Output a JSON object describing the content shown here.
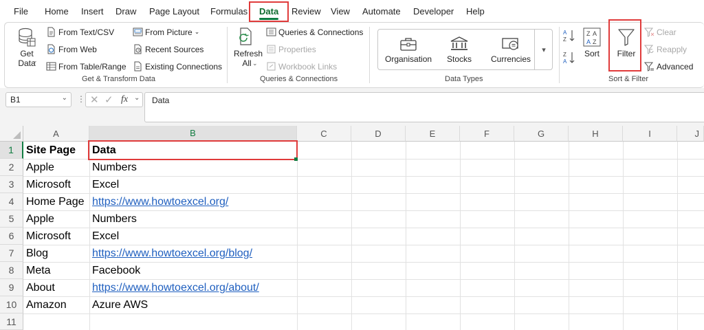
{
  "menu": {
    "tabs": [
      "File",
      "Home",
      "Insert",
      "Draw",
      "Page Layout",
      "Formulas",
      "Data",
      "Review",
      "View",
      "Automate",
      "Developer",
      "Help"
    ],
    "active": "Data"
  },
  "ribbon": {
    "get_transform": {
      "get_data": "Get Data",
      "from_text_csv": "From Text/CSV",
      "from_web": "From Web",
      "from_table_range": "From Table/Range",
      "from_picture": "From Picture",
      "recent_sources": "Recent Sources",
      "existing_connections": "Existing Connections",
      "label": "Get & Transform Data"
    },
    "queries": {
      "refresh_all": "Refresh All",
      "queries_connections": "Queries & Connections",
      "properties": "Properties",
      "workbook_links": "Workbook Links",
      "label": "Queries & Connections"
    },
    "data_types": {
      "items": [
        "Organisation",
        "Stocks",
        "Currencies"
      ],
      "label": "Data Types"
    },
    "sort_filter": {
      "sort": "Sort",
      "filter": "Filter",
      "clear": "Clear",
      "reapply": "Reapply",
      "advanced": "Advanced",
      "label": "Sort & Filter"
    }
  },
  "formula_bar": {
    "name_box": "B1",
    "fx": "fx",
    "value": "Data"
  },
  "sheet": {
    "columns": [
      "A",
      "B",
      "C",
      "D",
      "E",
      "F",
      "G",
      "H",
      "I",
      "J"
    ],
    "rows": [
      "1",
      "2",
      "3",
      "4",
      "5",
      "6",
      "7",
      "8",
      "9",
      "10",
      "11"
    ],
    "selected_column": "B",
    "selected_row": "1",
    "cells": [
      {
        "a": "Site Page",
        "b": "Data"
      },
      {
        "a": "Apple",
        "b": "Numbers"
      },
      {
        "a": "Microsoft",
        "b": "Excel"
      },
      {
        "a": "Home Page",
        "b": "https://www.howtoexcel.org/"
      },
      {
        "a": "Apple",
        "b": "Numbers"
      },
      {
        "a": "Microsoft",
        "b": "Excel"
      },
      {
        "a": "Blog",
        "b": "https://www.howtoexcel.org/blog/"
      },
      {
        "a": "Meta",
        "b": "Facebook"
      },
      {
        "a": "About",
        "b": "https://www.howtoexcel.org/about/"
      },
      {
        "a": "Amazon",
        "b": "Azure AWS"
      },
      {
        "a": "",
        "b": ""
      }
    ]
  },
  "colors": {
    "accent": "#107c41",
    "highlight": "#e03a3a",
    "link": "#1f5fbf"
  }
}
